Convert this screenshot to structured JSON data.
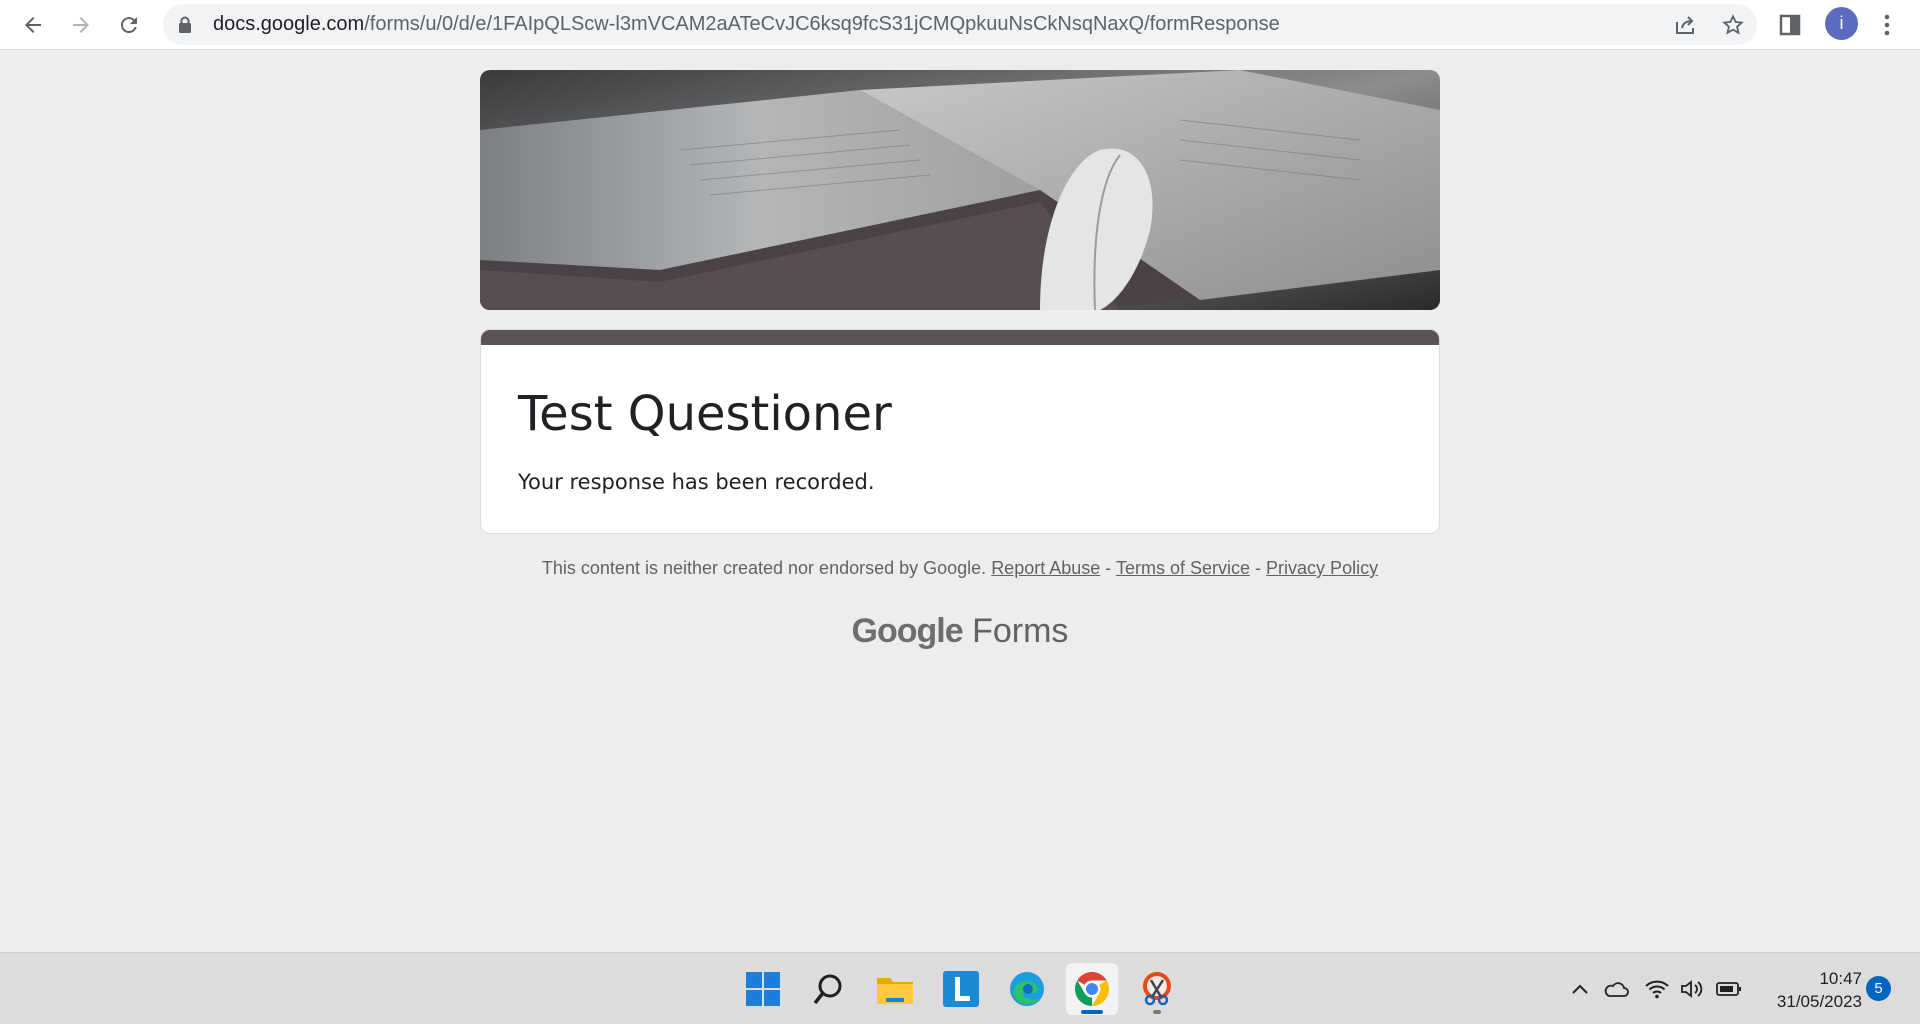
{
  "browser": {
    "url_host": "docs.google.com",
    "url_path": "/forms/u/0/d/e/1FAIpQLScw-l3mVCAM2aATeCvJC6ksq9fcS31jCMQpkuuNsCkNsqNaxQ/formResponse",
    "profile_initial": "i"
  },
  "form": {
    "title": "Test Questioner",
    "message": "Your response has been recorded."
  },
  "footer": {
    "disclaimer": "This content is neither created nor endorsed by Google.",
    "report_abuse": "Report Abuse",
    "sep1": "-",
    "terms": "Terms of Service",
    "sep2": "-",
    "privacy": "Privacy Policy",
    "brand_google": "Google",
    "brand_forms": "Forms"
  },
  "taskbar": {
    "time": "10:47",
    "date": "31/05/2023",
    "notification_count": "5"
  },
  "colors": {
    "accent": "#5c5454",
    "background": "#eeedeb"
  }
}
